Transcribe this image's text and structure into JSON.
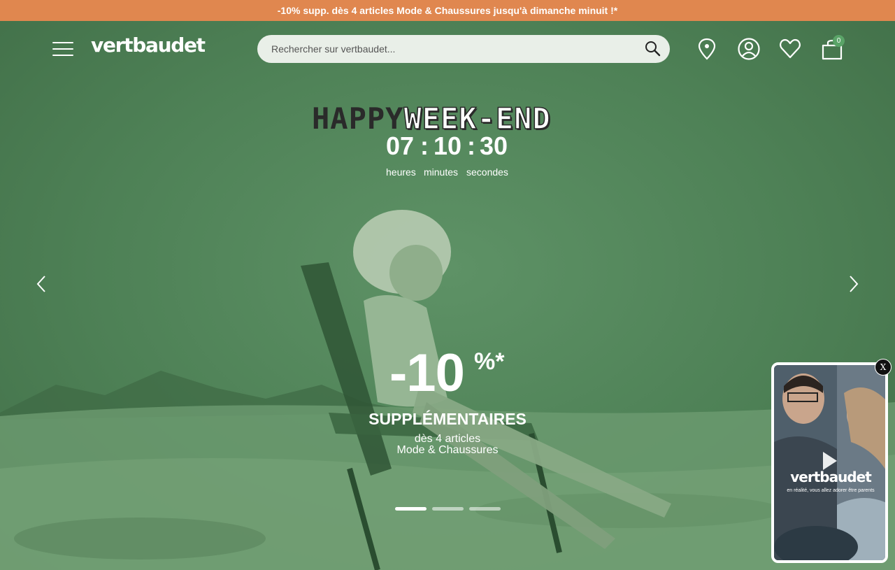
{
  "promo_bar": {
    "text": "-10% supp. dès 4 articles Mode & Chaussures jusqu'à dimanche minuit !*"
  },
  "header": {
    "logo": "vertbaudet",
    "search": {
      "placeholder": "Rechercher sur vertbaudet..."
    },
    "cart_count": "0",
    "icons": [
      "menu-icon",
      "search-icon",
      "store-locator-icon",
      "account-icon",
      "wishlist-icon",
      "cart-icon"
    ]
  },
  "hero": {
    "happy": "HAPPY",
    "weekend": "WEEK-END",
    "countdown": {
      "hours": "07",
      "minutes": "10",
      "seconds": "30",
      "separator": ":"
    },
    "labels": {
      "hours": "heures",
      "minutes": "minutes",
      "seconds": "secondes"
    },
    "discount": "-10",
    "percent": "%*",
    "title": "SUPPLÉMENTAIRES",
    "line1": "dès 4 articles",
    "line2": "Mode & Chaussures",
    "slides": 3,
    "active_slide": 1
  },
  "video_widget": {
    "close_label": "X",
    "logo": "vertbaudet",
    "tagline": "en réalité, vous allez adorer être parents"
  },
  "colors": {
    "promo_bar": "#e0874f",
    "hero_tint": "#4f7f56",
    "cart_badge": "#5aa468",
    "search_bg": "#e9efe8"
  }
}
